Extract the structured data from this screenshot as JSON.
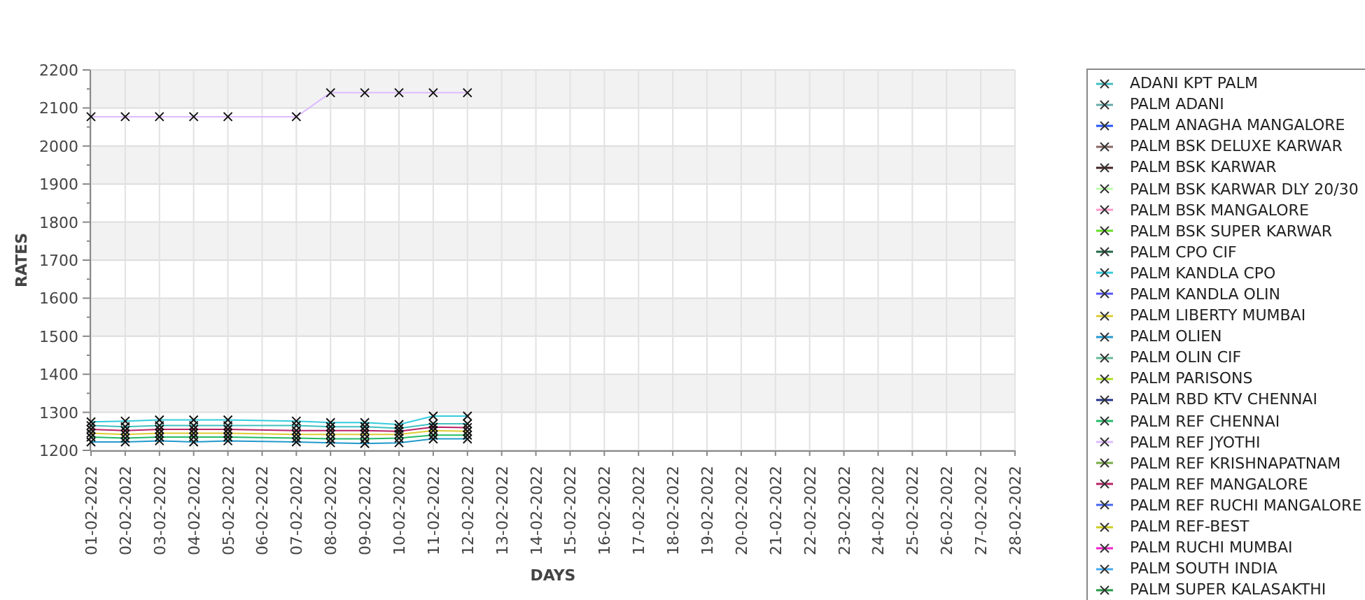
{
  "chart": {
    "chart_data": {
      "type": "line",
      "xlabel": "DAYS",
      "ylabel": "RATES",
      "grid": true,
      "categories": [
        "01-02-2022",
        "02-02-2022",
        "03-02-2022",
        "04-02-2022",
        "05-02-2022",
        "06-02-2022",
        "07-02-2022",
        "08-02-2022",
        "09-02-2022",
        "10-02-2022",
        "11-02-2022",
        "12-02-2022",
        "13-02-2022",
        "14-02-2022",
        "15-02-2022",
        "16-02-2022",
        "17-02-2022",
        "18-02-2022",
        "19-02-2022",
        "20-02-2022",
        "21-02-2022",
        "22-02-2022",
        "23-02-2022",
        "24-02-2022",
        "25-02-2022",
        "26-02-2022",
        "27-02-2022",
        "28-02-2022"
      ],
      "ylim": [
        1200,
        2200
      ],
      "yticks": [
        1200,
        1300,
        1400,
        1500,
        1600,
        1700,
        1800,
        1900,
        2000,
        2100,
        2200
      ],
      "series": [
        {
          "name": "ADANI KPT PALM",
          "color": "#40c0c0",
          "marker": "cross",
          "values": [
            1265,
            1262,
            1265,
            1265,
            1265,
            null,
            1265,
            1262,
            1262,
            1258,
            1270,
            1270,
            null,
            null,
            null,
            null,
            null,
            null,
            null,
            null,
            null,
            null,
            null,
            null,
            null,
            null,
            null,
            null
          ]
        },
        {
          "name": "PALM ADANI",
          "color": "#66aaaa",
          "marker": "cross",
          "values": [
            null,
            null,
            null,
            null,
            null,
            null,
            null,
            null,
            null,
            null,
            null,
            null,
            null,
            null,
            null,
            null,
            null,
            null,
            null,
            null,
            null,
            null,
            null,
            null,
            null,
            null,
            null,
            null
          ]
        },
        {
          "name": "PALM ANAGHA MANGALORE",
          "color": "#2255ff",
          "marker": "cross",
          "values": [
            null,
            null,
            null,
            null,
            null,
            null,
            null,
            null,
            null,
            null,
            null,
            null,
            null,
            null,
            null,
            null,
            null,
            null,
            null,
            null,
            null,
            null,
            null,
            null,
            null,
            null,
            null,
            null
          ]
        },
        {
          "name": "PALM BSK DELUXE KARWAR",
          "color": "#886666",
          "marker": "cross",
          "values": [
            null,
            null,
            null,
            null,
            null,
            null,
            null,
            null,
            null,
            null,
            null,
            null,
            null,
            null,
            null,
            null,
            null,
            null,
            null,
            null,
            null,
            null,
            null,
            null,
            null,
            null,
            null,
            null
          ]
        },
        {
          "name": "PALM BSK KARWAR",
          "color": "#442222",
          "marker": "cross",
          "values": [
            null,
            null,
            null,
            null,
            null,
            null,
            null,
            null,
            null,
            null,
            null,
            null,
            null,
            null,
            null,
            null,
            null,
            null,
            null,
            null,
            null,
            null,
            null,
            null,
            null,
            null,
            null,
            null
          ]
        },
        {
          "name": "PALM BSK KARWAR DLY 20/30",
          "color": "#bbffaa",
          "marker": "cross",
          "values": [
            null,
            null,
            null,
            null,
            null,
            null,
            null,
            null,
            null,
            null,
            null,
            null,
            null,
            null,
            null,
            null,
            null,
            null,
            null,
            null,
            null,
            null,
            null,
            null,
            null,
            null,
            null,
            null
          ]
        },
        {
          "name": "PALM BSK MANGALORE",
          "color": "#ff99cc",
          "marker": "cross",
          "values": [
            null,
            null,
            null,
            null,
            null,
            null,
            null,
            null,
            null,
            null,
            null,
            null,
            null,
            null,
            null,
            null,
            null,
            null,
            null,
            null,
            null,
            null,
            null,
            null,
            null,
            null,
            null,
            null
          ]
        },
        {
          "name": "PALM BSK SUPER KARWAR",
          "color": "#66dd22",
          "marker": "cross",
          "values": [
            null,
            null,
            null,
            null,
            null,
            null,
            null,
            null,
            null,
            null,
            null,
            null,
            null,
            null,
            null,
            null,
            null,
            null,
            null,
            null,
            null,
            null,
            null,
            null,
            null,
            null,
            null,
            null
          ]
        },
        {
          "name": "PALM CPO CIF",
          "color": "#226644",
          "marker": "cross",
          "values": [
            null,
            null,
            null,
            null,
            null,
            null,
            null,
            null,
            null,
            null,
            null,
            null,
            null,
            null,
            null,
            null,
            null,
            null,
            null,
            null,
            null,
            null,
            null,
            null,
            null,
            null,
            null,
            null
          ]
        },
        {
          "name": "PALM KANDLA CPO",
          "color": "#33ccdd",
          "marker": "cross",
          "values": [
            1275,
            1277,
            1280,
            1280,
            1280,
            null,
            1277,
            1273,
            1273,
            1268,
            1290,
            1290,
            null,
            null,
            null,
            null,
            null,
            null,
            null,
            null,
            null,
            null,
            null,
            null,
            null,
            null,
            null,
            null
          ]
        },
        {
          "name": "PALM KANDLA OLIN",
          "color": "#5555ff",
          "marker": "cross",
          "values": [
            null,
            null,
            null,
            null,
            null,
            null,
            null,
            null,
            null,
            null,
            null,
            null,
            null,
            null,
            null,
            null,
            null,
            null,
            null,
            null,
            null,
            null,
            null,
            null,
            null,
            null,
            null,
            null
          ]
        },
        {
          "name": "PALM LIBERTY MUMBAI",
          "color": "#ddcc33",
          "marker": "cross",
          "values": [
            1245,
            1242,
            1245,
            1245,
            1245,
            null,
            1242,
            1242,
            1242,
            1242,
            1252,
            1250,
            null,
            null,
            null,
            null,
            null,
            null,
            null,
            null,
            null,
            null,
            null,
            null,
            null,
            null,
            null,
            null
          ]
        },
        {
          "name": "PALM OLIEN",
          "color": "#2299cc",
          "marker": "cross",
          "values": [
            1222,
            1222,
            1225,
            1222,
            1225,
            null,
            1222,
            1220,
            1218,
            1220,
            1230,
            1230,
            null,
            null,
            null,
            null,
            null,
            null,
            null,
            null,
            null,
            null,
            null,
            null,
            null,
            null,
            null,
            null
          ]
        },
        {
          "name": "PALM OLIN CIF",
          "color": "#66bb99",
          "marker": "cross",
          "values": [
            null,
            null,
            null,
            null,
            null,
            null,
            null,
            null,
            null,
            null,
            null,
            null,
            null,
            null,
            null,
            null,
            null,
            null,
            null,
            null,
            null,
            null,
            null,
            null,
            null,
            null,
            null,
            null
          ]
        },
        {
          "name": "PALM PARISONS",
          "color": "#aadd22",
          "marker": "cross",
          "values": [
            null,
            null,
            null,
            null,
            null,
            null,
            null,
            null,
            null,
            null,
            null,
            null,
            null,
            null,
            null,
            null,
            null,
            null,
            null,
            null,
            null,
            null,
            null,
            null,
            null,
            null,
            null,
            null
          ]
        },
        {
          "name": "PALM RBD KTV CHENNAI",
          "color": "#223388",
          "marker": "cross",
          "values": [
            null,
            null,
            null,
            null,
            null,
            null,
            null,
            null,
            null,
            null,
            null,
            null,
            null,
            null,
            null,
            null,
            null,
            null,
            null,
            null,
            null,
            null,
            null,
            null,
            null,
            null,
            null,
            null
          ]
        },
        {
          "name": "PALM REF CHENNAI",
          "color": "#22bb66",
          "marker": "cross",
          "values": [
            1235,
            1232,
            1235,
            1235,
            1235,
            null,
            1232,
            1230,
            1230,
            1232,
            1240,
            1240,
            null,
            null,
            null,
            null,
            null,
            null,
            null,
            null,
            null,
            null,
            null,
            null,
            null,
            null,
            null,
            null
          ]
        },
        {
          "name": "PALM REF JYOTHI",
          "color": "#ddbbff",
          "marker": "cross",
          "values": [
            2077,
            2077,
            2077,
            2077,
            2077,
            null,
            2077,
            2140,
            2140,
            2140,
            2140,
            2140,
            null,
            null,
            null,
            null,
            null,
            null,
            null,
            null,
            null,
            null,
            null,
            null,
            null,
            null,
            null,
            null
          ]
        },
        {
          "name": "PALM REF KRISHNAPATNAM",
          "color": "#77aa44",
          "marker": "cross",
          "values": [
            null,
            null,
            null,
            null,
            null,
            null,
            null,
            null,
            null,
            null,
            null,
            null,
            null,
            null,
            null,
            null,
            null,
            null,
            null,
            null,
            null,
            null,
            null,
            null,
            null,
            null,
            null,
            null
          ]
        },
        {
          "name": "PALM REF MANGALORE",
          "color": "#bb2266",
          "marker": "cross",
          "values": [
            1255,
            1252,
            1255,
            1255,
            1255,
            null,
            1252,
            1252,
            1252,
            1250,
            1261,
            1260,
            null,
            null,
            null,
            null,
            null,
            null,
            null,
            null,
            null,
            null,
            null,
            null,
            null,
            null,
            null,
            null
          ]
        },
        {
          "name": "PALM REF RUCHI MANGALORE",
          "color": "#4466ee",
          "marker": "cross",
          "values": [
            null,
            null,
            null,
            null,
            null,
            null,
            null,
            null,
            null,
            null,
            null,
            null,
            null,
            null,
            null,
            null,
            null,
            null,
            null,
            null,
            null,
            null,
            null,
            null,
            null,
            null,
            null,
            null
          ]
        },
        {
          "name": "PALM REF-BEST",
          "color": "#cccc22",
          "marker": "cross",
          "values": [
            null,
            null,
            null,
            null,
            null,
            null,
            null,
            null,
            null,
            null,
            null,
            null,
            null,
            null,
            null,
            null,
            null,
            null,
            null,
            null,
            null,
            null,
            null,
            null,
            null,
            null,
            null,
            null
          ]
        },
        {
          "name": "PALM RUCHI MUMBAI",
          "color": "#ee22cc",
          "marker": "cross",
          "values": [
            null,
            null,
            null,
            null,
            null,
            null,
            null,
            null,
            null,
            null,
            null,
            null,
            null,
            null,
            null,
            null,
            null,
            null,
            null,
            null,
            null,
            null,
            null,
            null,
            null,
            null,
            null,
            null
          ]
        },
        {
          "name": "PALM SOUTH INDIA",
          "color": "#44aaee",
          "marker": "cross",
          "values": [
            null,
            null,
            null,
            null,
            null,
            null,
            null,
            null,
            null,
            null,
            null,
            null,
            null,
            null,
            null,
            null,
            null,
            null,
            null,
            null,
            null,
            null,
            null,
            null,
            null,
            null,
            null,
            null
          ]
        },
        {
          "name": "PALM SUPER KALASAKTHI",
          "color": "#229944",
          "marker": "cross",
          "values": [
            null,
            null,
            null,
            null,
            null,
            null,
            null,
            null,
            null,
            null,
            null,
            null,
            null,
            null,
            null,
            null,
            null,
            null,
            null,
            null,
            null,
            null,
            null,
            null,
            null,
            null,
            null,
            null
          ]
        }
      ]
    }
  }
}
